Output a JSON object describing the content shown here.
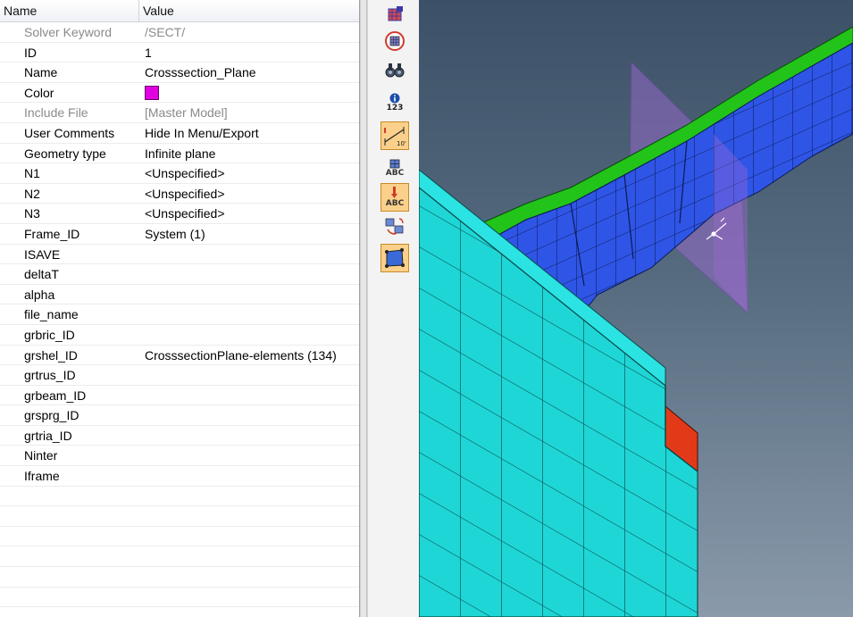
{
  "panel": {
    "col_name": "Name",
    "col_value": "Value",
    "rows": [
      {
        "name": "Solver Keyword",
        "value": "/SECT/",
        "muted": true
      },
      {
        "name": "ID",
        "value": "1"
      },
      {
        "name": "Name",
        "value": "Crosssection_Plane"
      },
      {
        "name": "Color",
        "value": "",
        "swatch": "#e000e0"
      },
      {
        "name": "Include File",
        "value": "[Master Model]",
        "muted": true
      },
      {
        "name": "User Comments",
        "value": "Hide In Menu/Export"
      },
      {
        "name": "Geometry type",
        "value": "Infinite plane"
      },
      {
        "name": "N1",
        "value": "<Unspecified>"
      },
      {
        "name": "N2",
        "value": "<Unspecified>"
      },
      {
        "name": "N3",
        "value": "<Unspecified>"
      },
      {
        "name": "Frame_ID",
        "value": "System (1)"
      },
      {
        "name": "ISAVE",
        "value": ""
      },
      {
        "name": "deltaT",
        "value": ""
      },
      {
        "name": "alpha",
        "value": ""
      },
      {
        "name": "file_name",
        "value": ""
      },
      {
        "name": "grbric_ID",
        "value": ""
      },
      {
        "name": "grshel_ID",
        "value": "CrosssectionPlane-elements (134)"
      },
      {
        "name": "grtrus_ID",
        "value": ""
      },
      {
        "name": "grbeam_ID",
        "value": ""
      },
      {
        "name": "grsprg_ID",
        "value": ""
      },
      {
        "name": "grtria_ID",
        "value": ""
      },
      {
        "name": "Ninter",
        "value": ""
      },
      {
        "name": "Iframe",
        "value": ""
      }
    ]
  },
  "toolbar": {
    "buttons": [
      {
        "icon": "component-color-icon"
      },
      {
        "icon": "mesh-sphere-icon"
      },
      {
        "icon": "binoculars-icon"
      },
      {
        "icon": "info-123-icon",
        "text": "123"
      },
      {
        "icon": "measure-scale-icon",
        "active": true
      },
      {
        "icon": "abc-label-icon",
        "text": "ABC"
      },
      {
        "icon": "abc-marker-icon",
        "text": "ABC",
        "active": true
      },
      {
        "icon": "move-nodes-icon"
      },
      {
        "icon": "plane-box-icon",
        "active": true
      }
    ]
  },
  "colors": {
    "wall": "#1fd6d6",
    "beam_blue": "#2f55e6",
    "beam_green": "#22c41a",
    "plane": "#a26ad6",
    "red_elem": "#e23a18"
  }
}
